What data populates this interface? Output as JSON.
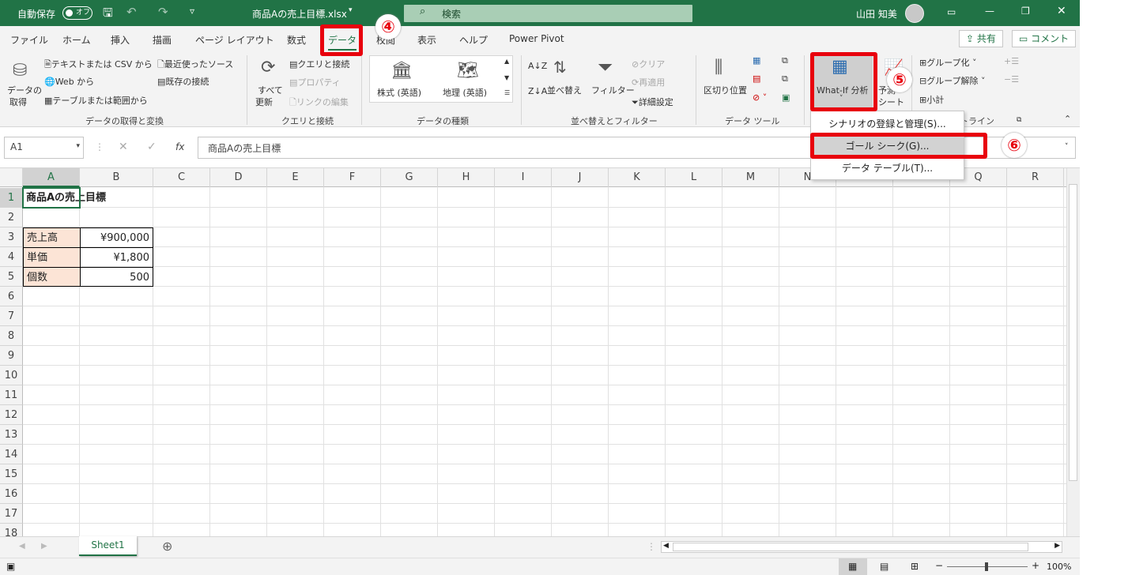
{
  "titlebar": {
    "autosave": "自動保存",
    "toggle": "オフ",
    "filename": "商品Aの売上目標.xlsx",
    "search": "検索",
    "user": "山田 知美"
  },
  "tabs": [
    "ファイル",
    "ホーム",
    "挿入",
    "描画",
    "ページ レイアウト",
    "数式",
    "データ",
    "校閲",
    "表示",
    "ヘルプ",
    "Power Pivot"
  ],
  "share": "共有",
  "comment": "コメント",
  "ribbon": {
    "get_data": "データの",
    "get_data2": "取得",
    "from_text": "テキストまたは CSV から",
    "from_web": "Web から",
    "from_table": "テーブルまたは範囲から",
    "recent": "最近使ったソース",
    "existing": "既存の接続",
    "g1": "データの取得と変換",
    "refresh": "すべて",
    "refresh2": "更新",
    "queries": "クエリと接続",
    "props": "プロパティ",
    "links": "リンクの編集",
    "g2": "クエリと接続",
    "stocks": "株式 (英語)",
    "geo": "地理 (英語)",
    "g3": "データの種類",
    "sort": "並べ替え",
    "filter": "フィルター",
    "clear": "クリア",
    "reapply": "再適用",
    "advanced": "詳細設定",
    "g4": "並べ替えとフィルター",
    "split": "区切り位置",
    "g5": "データ ツール",
    "whatif": "What-If 分析",
    "forecast": "予測",
    "forecast2": "シート",
    "group": "グループ化",
    "ungroup": "グループ解除",
    "subtotal": "小計",
    "g6": "アウトライン"
  },
  "menu": {
    "scenario": "シナリオの登録と管理(S)...",
    "goalseek": "ゴール シーク(G)...",
    "datatable": "データ テーブル(T)..."
  },
  "badges": {
    "b4": "④",
    "b5": "⑤",
    "b6": "⑥"
  },
  "formula": {
    "namebox": "A1",
    "fx": "fx",
    "content": "商品Aの売上目標"
  },
  "columns": [
    "A",
    "B",
    "C",
    "D",
    "E",
    "F",
    "G",
    "H",
    "I",
    "J",
    "K",
    "L",
    "M",
    "N",
    "O",
    "P",
    "Q",
    "R"
  ],
  "rows": [
    "1",
    "2",
    "3",
    "4",
    "5",
    "6",
    "7",
    "8",
    "9",
    "10",
    "11",
    "12",
    "13",
    "14",
    "15",
    "16",
    "17",
    "18"
  ],
  "cells": {
    "a1": "商品Aの売上目標",
    "a3": "売上高",
    "b3": "¥900,000",
    "a4": "単価",
    "b4": "¥1,800",
    "a5": "個数",
    "b5": "500"
  },
  "sheet": "Sheet1",
  "zoom": "100%",
  "colors": {
    "brand": "#217346",
    "highlight": "#e8000d",
    "label_fill": "#fce4d6"
  }
}
